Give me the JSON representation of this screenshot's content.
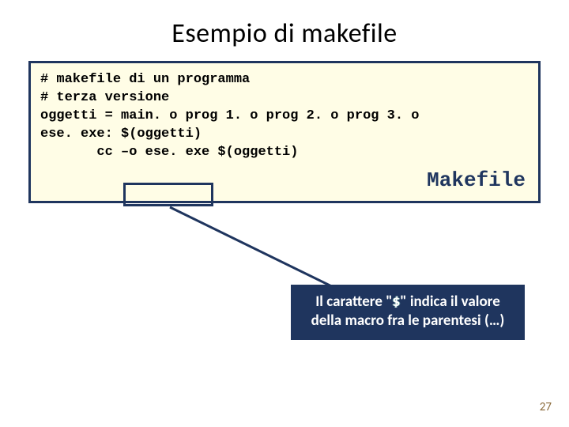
{
  "title": "Esempio di makefile",
  "code": {
    "l1": "# makefile di un programma",
    "l2": "# terza versione",
    "l3": "",
    "l4": "oggetti = main. o prog 1. o prog 2. o prog 3. o",
    "l5": "",
    "l6": "ese. exe: $(oggetti)",
    "l7": "       cc –o ese. exe $(oggetti)"
  },
  "makefile_label": "Makefile",
  "note": {
    "prefix": "Il carattere \"",
    "dollar": "$",
    "mid": "\" indica il valore della macro fra le parentesi (…)"
  },
  "page_number": "27"
}
